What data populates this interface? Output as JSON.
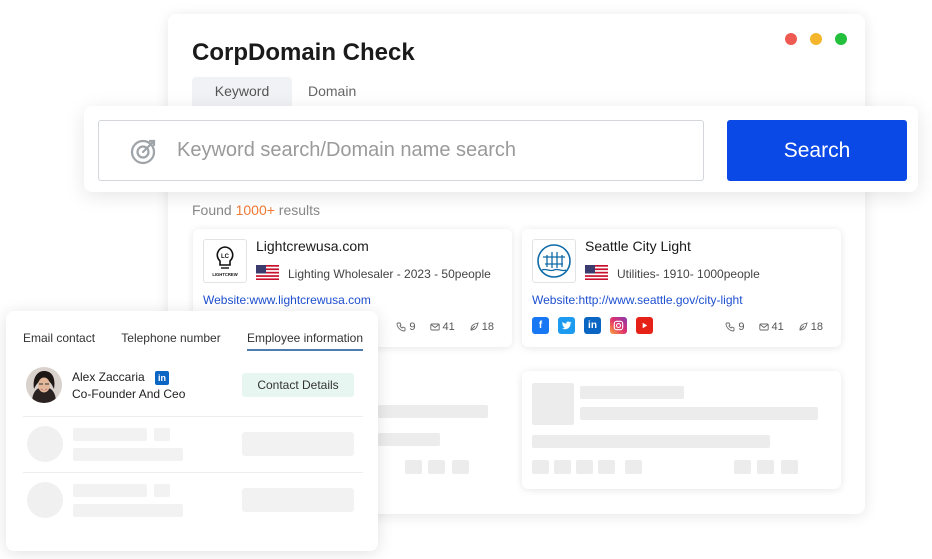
{
  "app": {
    "title": "CorpDomain Check",
    "window_dots": [
      "#ee5a52",
      "#f5b52a",
      "#22c03c"
    ]
  },
  "tabs": [
    {
      "label": "Keyword",
      "active": true
    },
    {
      "label": "Domain",
      "active": false
    }
  ],
  "search": {
    "placeholder": "Keyword search/Domain name search",
    "value": "",
    "button_label": "Search"
  },
  "results": {
    "prefix": "Found ",
    "count": "1000+",
    "suffix": " results"
  },
  "companies": [
    {
      "name": "Lightcrewusa.com",
      "logo_text": "LIGHTCREW",
      "logo_initials": "LC",
      "description": "Lighting Wholesaler - 2023 - 50people",
      "website": "Website:www.lightcrewusa.com",
      "stats": {
        "phone": "9",
        "email": "41",
        "other": "18"
      }
    },
    {
      "name": "Seattle City Light",
      "description": "Utilities- 1910- 1000people",
      "website": "Website:http://www.seattle.gov/city-light",
      "socials": [
        "facebook-icon",
        "twitter-icon",
        "linkedin-icon",
        "instagram-icon",
        "youtube-icon"
      ],
      "stats": {
        "phone": "9",
        "email": "41",
        "other": "18"
      }
    }
  ],
  "employee_panel": {
    "tabs": [
      {
        "label": "Email contact",
        "active": false
      },
      {
        "label": "Telephone number",
        "active": false
      },
      {
        "label": "Employee information",
        "active": true
      }
    ],
    "employees": [
      {
        "name": "Alex Zaccaria",
        "title": "Co-Founder And Ceo",
        "badge": "in",
        "action_label": "Contact Details"
      }
    ]
  },
  "colors": {
    "accent": "#0a49e6",
    "highlight": "#f07a35",
    "link": "#1d4fcf"
  }
}
